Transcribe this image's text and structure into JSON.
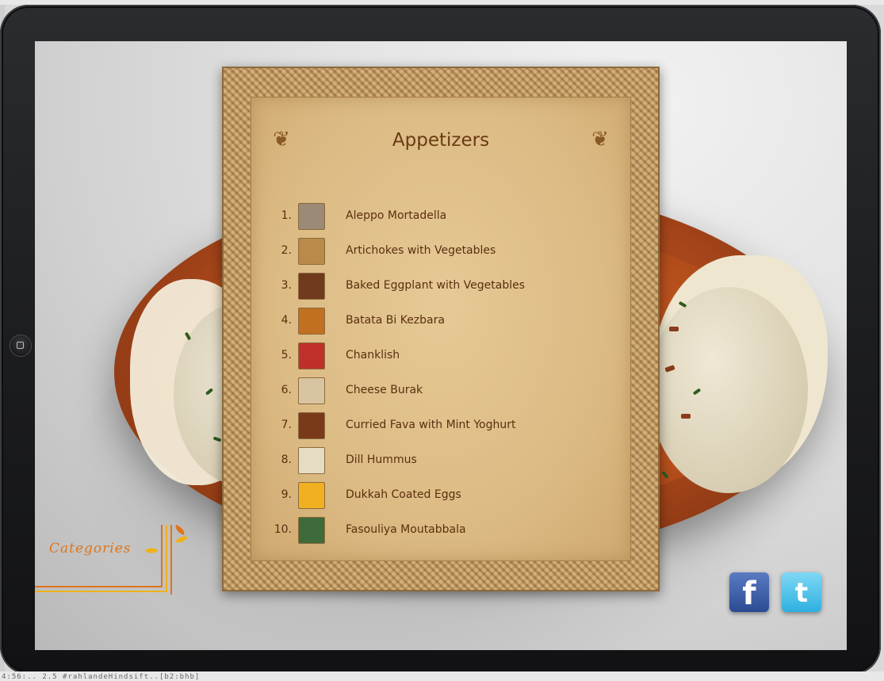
{
  "status_strip_text": "4:56:.. 2.5 #rahlandeHindsift..[b2:bhb]",
  "menu": {
    "title": "Appetizers",
    "items": [
      {
        "number": "1.",
        "name": "Aleppo Mortadella",
        "thumb_color": "#9a8a76"
      },
      {
        "number": "2.",
        "name": "Artichokes with Vegetables",
        "thumb_color": "#b98a4a"
      },
      {
        "number": "3.",
        "name": "Baked Eggplant with Vegetables",
        "thumb_color": "#6f3a1d"
      },
      {
        "number": "4.",
        "name": "Batata Bi Kezbara",
        "thumb_color": "#c07020"
      },
      {
        "number": "5.",
        "name": "Chanklish",
        "thumb_color": "#c0302a"
      },
      {
        "number": "6.",
        "name": "Cheese Burak",
        "thumb_color": "#d8c4a0"
      },
      {
        "number": "7.",
        "name": "Curried Fava with Mint Yoghurt",
        "thumb_color": "#7a3a1a"
      },
      {
        "number": "8.",
        "name": "Dill Hummus",
        "thumb_color": "#e6dcc4"
      },
      {
        "number": "9.",
        "name": "Dukkah Coated Eggs",
        "thumb_color": "#f0b020"
      },
      {
        "number": "10.",
        "name": "Fasouliya Moutabbala",
        "thumb_color": "#3f6a3a"
      }
    ]
  },
  "categories": {
    "label": "Categories"
  },
  "social": {
    "facebook_icon": "facebook-icon",
    "twitter_icon": "twitter-icon",
    "facebook_glyph": "f",
    "twitter_glyph": "t"
  },
  "colors": {
    "title": "#6a3a12",
    "item_text": "#5a2f0e",
    "categories": "#e0741c",
    "facebook": "#3b5998",
    "twitter": "#2eb0e0"
  }
}
